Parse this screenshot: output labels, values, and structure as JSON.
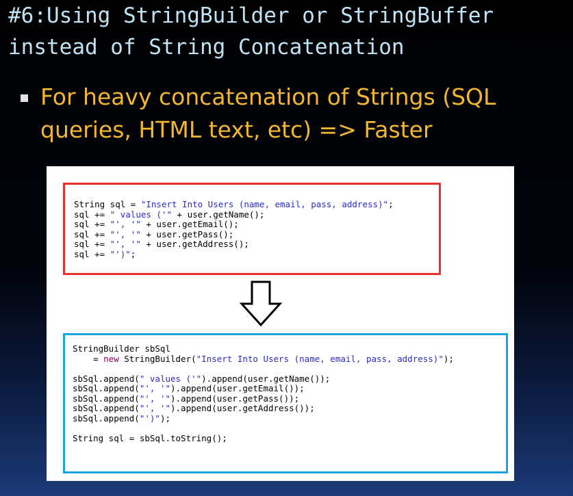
{
  "slide": {
    "title": "#6:Using StringBuilder or StringBuffer\ninstead of String Concatenation",
    "bullet": "For heavy concatenation of Strings (SQL queries, HTML text, etc) => Faster"
  },
  "code_before": {
    "lines": [
      "String sql = \"Insert Into Users (name, email, pass, address)\";",
      "sql += \" values ('\" + user.getName();",
      "sql += \"', '\" + user.getEmail();",
      "sql += \"', '\" + user.getPass();",
      "sql += \"', '\" + user.getAddress();",
      "sql += \"')\";"
    ]
  },
  "code_after": {
    "lines": [
      "StringBuilder sbSql",
      "    = new StringBuilder(\"Insert Into Users (name, email, pass, address)\");",
      "",
      "sbSql.append(\" values ('\").append(user.getName());",
      "sbSql.append(\"', '\").append(user.getEmail());",
      "sbSql.append(\"', '\").append(user.getPass());",
      "sbSql.append(\"', '\").append(user.getAddress());",
      "sbSql.append(\"')\");",
      "",
      "String sql = sbSql.toString();"
    ]
  },
  "icons": {
    "arrow": "down-arrow-icon"
  },
  "colors": {
    "title": "#bfe3f5",
    "bullet_text": "#f2b72e",
    "before_border": "#e8302c",
    "after_border": "#1aa4df",
    "string_literal": "#2a2acc"
  }
}
